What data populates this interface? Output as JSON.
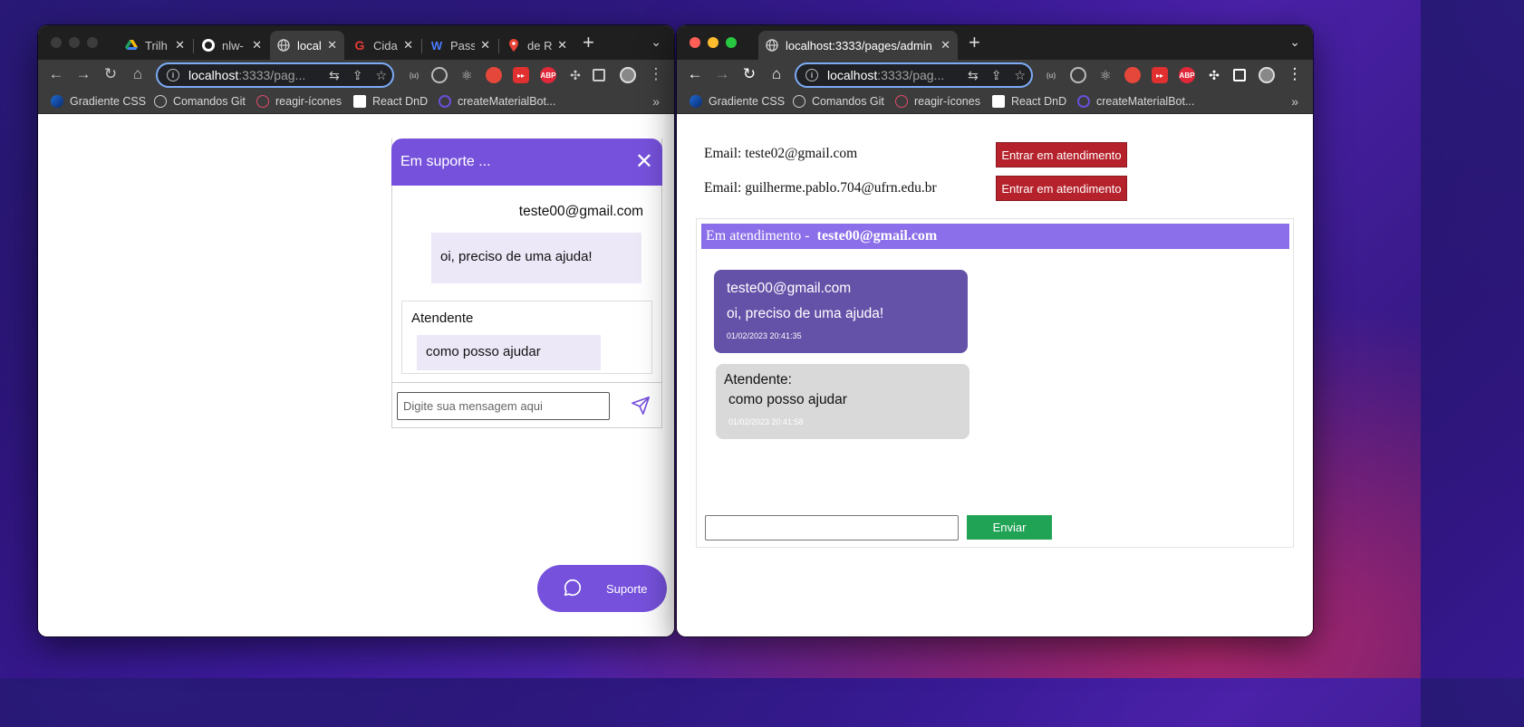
{
  "left_window": {
    "tabs": [
      {
        "title": "Trilh",
        "icon": "google-drive-icon"
      },
      {
        "title": "nlw-",
        "icon": "github-icon"
      },
      {
        "title": "local",
        "icon": "globe-icon",
        "active": true
      },
      {
        "title": "Cida",
        "icon": "g-logo-icon"
      },
      {
        "title": "Pass",
        "icon": "w-logo-icon"
      },
      {
        "title": "de R",
        "icon": "maps-pin-icon"
      }
    ],
    "address": {
      "host": "localhost",
      "path": ":3333/pag..."
    },
    "bookmarks": [
      "Gradiente CSS",
      "Comandos Git",
      "reagir-ícones",
      "React DnD",
      "createMaterialBot..."
    ]
  },
  "right_window": {
    "tab_title": "localhost:3333/pages/admin",
    "address": {
      "host": "localhost",
      "path": ":3333/pag..."
    },
    "bookmarks": [
      "Gradiente CSS",
      "Comandos Git",
      "reagir-ícones",
      "React DnD",
      "createMaterialBot..."
    ]
  },
  "chat": {
    "header": "Em suporte ...",
    "user_email": "teste00@gmail.com",
    "user_message": "oi, preciso de uma ajuda!",
    "agent_label": "Atendente",
    "agent_message": "como posso ajudar",
    "input_placeholder": "Digite sua mensagem aqui",
    "support_button": "Suporte"
  },
  "admin": {
    "rows": [
      {
        "email": "Email: teste02@gmail.com",
        "button": "Entrar em atendimento"
      },
      {
        "email": "Email: guilherme.pablo.704@ufrn.edu.br",
        "button": "Entrar em atendimento"
      }
    ],
    "attend_prefix": "Em atendimento -",
    "attend_email": "teste00@gmail.com",
    "user_msg": {
      "email": "teste00@gmail.com",
      "text": "oi, preciso de uma ajuda!",
      "date": "01/02/2023 20:41:35"
    },
    "agent_msg": {
      "label": "Atendente:",
      "text": "como posso ajudar",
      "date": "01/02/2023 20:41:58"
    },
    "send_button": "Enviar"
  },
  "colors": {
    "accent": "#7651dc",
    "header_bar": "#8b6ee9",
    "danger": "#b5222c",
    "success": "#21a355"
  }
}
